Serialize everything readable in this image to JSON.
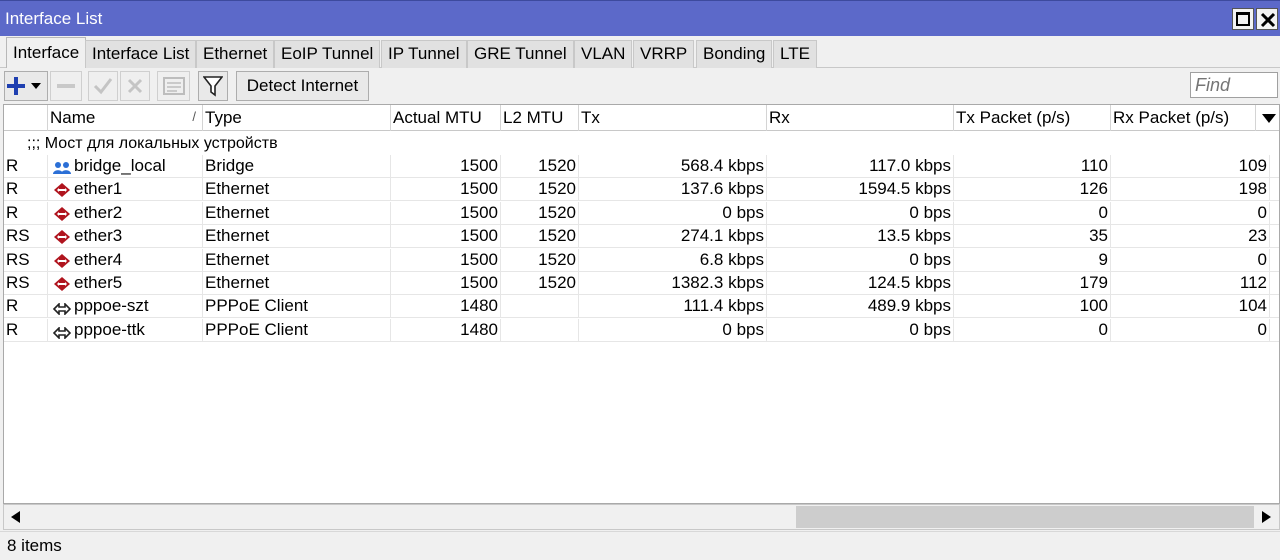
{
  "window": {
    "title": "Interface List"
  },
  "tabs": [
    "Interface",
    "Interface List",
    "Ethernet",
    "EoIP Tunnel",
    "IP Tunnel",
    "GRE Tunnel",
    "VLAN",
    "VRRP",
    "Bonding",
    "LTE"
  ],
  "toolbar": {
    "detect_label": "Detect Internet",
    "find_placeholder": "Find",
    "icons": [
      "plus-icon",
      "dropdown-arrow-icon",
      "minus-icon",
      "check-icon",
      "cross-icon",
      "comment-icon",
      "filter-icon"
    ]
  },
  "table": {
    "columns": [
      "Name",
      "Type",
      "Actual MTU",
      "L2 MTU",
      "Tx",
      "Rx",
      "Tx Packet (p/s)",
      "Rx Packet (p/s)"
    ],
    "sort_mark": "/",
    "comment": ";;; Мост для локальных устройств",
    "rows": [
      {
        "flags": "R",
        "icon": "bridge-icon",
        "name": "bridge_local",
        "type": "Bridge",
        "actual_mtu": "1500",
        "l2_mtu": "1520",
        "tx": "568.4 kbps",
        "rx": "117.0 kbps",
        "tx_pps": "110",
        "rx_pps": "109"
      },
      {
        "flags": "R",
        "icon": "ethernet-icon",
        "name": "ether1",
        "type": "Ethernet",
        "actual_mtu": "1500",
        "l2_mtu": "1520",
        "tx": "137.6 kbps",
        "rx": "1594.5 kbps",
        "tx_pps": "126",
        "rx_pps": "198"
      },
      {
        "flags": "R",
        "icon": "ethernet-icon",
        "name": "ether2",
        "type": "Ethernet",
        "actual_mtu": "1500",
        "l2_mtu": "1520",
        "tx": "0 bps",
        "rx": "0 bps",
        "tx_pps": "0",
        "rx_pps": "0"
      },
      {
        "flags": "RS",
        "icon": "ethernet-icon",
        "name": "ether3",
        "type": "Ethernet",
        "actual_mtu": "1500",
        "l2_mtu": "1520",
        "tx": "274.1 kbps",
        "rx": "13.5 kbps",
        "tx_pps": "35",
        "rx_pps": "23"
      },
      {
        "flags": "RS",
        "icon": "ethernet-icon",
        "name": "ether4",
        "type": "Ethernet",
        "actual_mtu": "1500",
        "l2_mtu": "1520",
        "tx": "6.8 kbps",
        "rx": "0 bps",
        "tx_pps": "9",
        "rx_pps": "0"
      },
      {
        "flags": "RS",
        "icon": "ethernet-icon",
        "name": "ether5",
        "type": "Ethernet",
        "actual_mtu": "1500",
        "l2_mtu": "1520",
        "tx": "1382.3 kbps",
        "rx": "124.5 kbps",
        "tx_pps": "179",
        "rx_pps": "112"
      },
      {
        "flags": "R",
        "icon": "pppoe-icon",
        "name": "pppoe-szt",
        "type": "PPPoE Client",
        "actual_mtu": "1480",
        "l2_mtu": "",
        "tx": "111.4 kbps",
        "rx": "489.9 kbps",
        "tx_pps": "100",
        "rx_pps": "104"
      },
      {
        "flags": "R",
        "icon": "pppoe-icon",
        "name": "pppoe-ttk",
        "type": "PPPoE Client",
        "actual_mtu": "1480",
        "l2_mtu": "",
        "tx": "0 bps",
        "rx": "0 bps",
        "tx_pps": "0",
        "rx_pps": "0"
      }
    ]
  },
  "status": {
    "items_count": "8 items"
  },
  "colors": {
    "titlebar": "#5c69c9",
    "accent": "#1f3fb0",
    "ethernet_icon": "#b0141e"
  }
}
